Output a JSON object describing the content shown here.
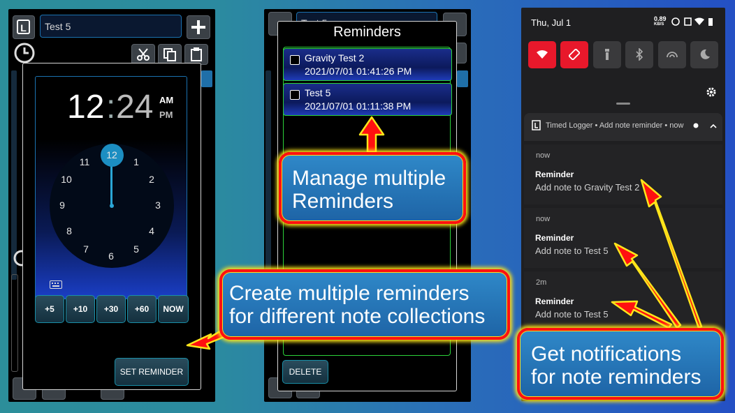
{
  "colors": {
    "accent_blue": "#1f6fa8",
    "notif_red": "#e8182b",
    "reminder_border": "#2bd23a",
    "callout_border": "#ff1010",
    "arrow_yellow": "#ffe51a"
  },
  "phone1": {
    "app_logo_letter": "L",
    "title_input_value": "Test 5",
    "toolbar_icons": [
      "plus-icon",
      "clock-icon",
      "scissors-icon",
      "copy-icon",
      "paste-icon"
    ],
    "picker": {
      "hour": "12",
      "colon": ":",
      "minute": "24",
      "am": "AM",
      "pm": "PM",
      "dial_selected": "12",
      "dial_numbers": [
        "12",
        "1",
        "2",
        "3",
        "4",
        "5",
        "6",
        "7",
        "8",
        "9",
        "10",
        "11"
      ],
      "quick_buttons": [
        "+5",
        "+10",
        "+30",
        "+60",
        "NOW"
      ],
      "set_reminder_label": "SET REMINDER"
    }
  },
  "phone2": {
    "title_input_value": "Test 5",
    "dialog_title": "Reminders",
    "reminders": [
      {
        "name": "Gravity Test 2",
        "datetime": "2021/07/01 01:41:26 PM",
        "checked": false
      },
      {
        "name": "Test 5",
        "datetime": "2021/07/01 01:11:38 PM",
        "checked": false
      }
    ],
    "delete_label": "DELETE"
  },
  "phone3": {
    "status_date": "Thu, Jul 1",
    "status_speed": "0.89",
    "status_speed_unit": "KB/S",
    "quick_settings": [
      "wifi-icon",
      "rotate-icon",
      "flashlight-icon",
      "bluetooth-icon",
      "hotspot-icon",
      "night-mode-icon"
    ],
    "notif_header": "Timed Logger • Add note reminder • now",
    "notifications": [
      {
        "time": "now",
        "title": "Reminder",
        "text": "Add note to Gravity Test 2"
      },
      {
        "time": "now",
        "title": "Reminder",
        "text": "Add note to Test 5"
      },
      {
        "time": "2m",
        "title": "Reminder",
        "text": "Add note to Test 5"
      }
    ]
  },
  "callouts": {
    "manage": [
      "Manage multiple",
      "Reminders"
    ],
    "create": [
      "Create multiple reminders",
      "for different note collections"
    ],
    "notify": [
      "Get notifications",
      "for note reminders"
    ]
  }
}
